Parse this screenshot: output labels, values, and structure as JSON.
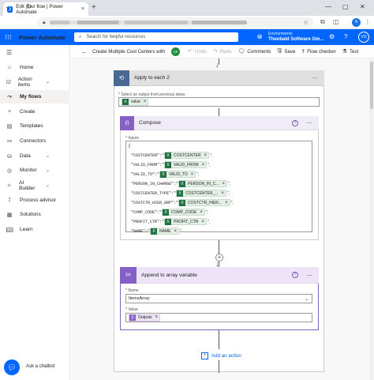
{
  "browser": {
    "tab_title": "Edit your flow | Power Automate",
    "tab_close": "×",
    "new_tab": "+",
    "min": "—",
    "restore": "▢",
    "close": "✕"
  },
  "header": {
    "brand": "Power Automate",
    "search_placeholder": "Search for helpful resources",
    "env_label": "Environments",
    "env_name": "Theobald Software Gm...",
    "avatar_initials": "VS",
    "accent": "#0066ff"
  },
  "sidebar": {
    "items": [
      {
        "label": "Home",
        "icon": "home-icon"
      },
      {
        "label": "Action items",
        "icon": "check-list-icon",
        "chevron": "⌄"
      },
      {
        "label": "My flows",
        "icon": "flow-icon",
        "active": true
      },
      {
        "label": "Create",
        "icon": "plus-icon"
      },
      {
        "label": "Templates",
        "icon": "template-icon"
      },
      {
        "label": "Connectors",
        "icon": "connector-icon"
      },
      {
        "label": "Data",
        "icon": "database-icon",
        "chevron": "⌄"
      },
      {
        "label": "Monitor",
        "icon": "monitor-icon",
        "chevron": "⌄"
      },
      {
        "label": "AI Builder",
        "icon": "ai-icon",
        "chevron": "⌄"
      },
      {
        "label": "Process advisor",
        "icon": "process-icon"
      },
      {
        "label": "Solutions",
        "icon": "solutions-icon"
      },
      {
        "label": "Learn",
        "icon": "learn-icon"
      }
    ],
    "chatbot_label": "Ask a chatbot"
  },
  "cmdbar": {
    "flow_name": "Create Multiple Cost Centers with",
    "copilot_initials": "CF",
    "undo": "Undo",
    "redo": "Redo",
    "comments": "Comments",
    "save": "Save",
    "flow_checker": "Flow checker",
    "test": "Test"
  },
  "apply_each": {
    "title": "Apply to each 2",
    "field_label": "* Select an output from previous steps",
    "token": "value"
  },
  "compose": {
    "title": "Compose",
    "inputs_label": "* Inputs",
    "open_brace": "{",
    "lines": [
      {
        "key": "\"COSTCENTER\":\"",
        "token": "COSTCENTER"
      },
      {
        "key": "\"VALID_FROM\":\"",
        "token": "VALID_FROM"
      },
      {
        "key": "\"VALID_TO\":\"",
        "token": "VALID_TO"
      },
      {
        "key": "\"PERSON_IN_CHARGE\":\"",
        "token": "PERSON_IN_C..."
      },
      {
        "key": "\"COSTCENTER_TYPE\":\"",
        "token": "COSTCENTER_..."
      },
      {
        "key": "\"COSTCTR_HIER_GRP\":\"",
        "token": "COSTCTR_HIER..."
      },
      {
        "key": "\"COMP_CODE\":\"",
        "token": "COMP_CODE"
      },
      {
        "key": "\"PROFIT_CTR\":\"",
        "token": "PROFIT_CTR"
      },
      {
        "key": "\"NAME\":\"",
        "token": "NAME"
      }
    ],
    "line_suffix": "\",",
    "last_suffix": "\""
  },
  "append": {
    "title": "Append to array variable",
    "name_label": "* Name",
    "name_value": "ItemsArray",
    "value_label": "* Value",
    "value_token": "Outputs"
  },
  "add_action": "Add an action"
}
